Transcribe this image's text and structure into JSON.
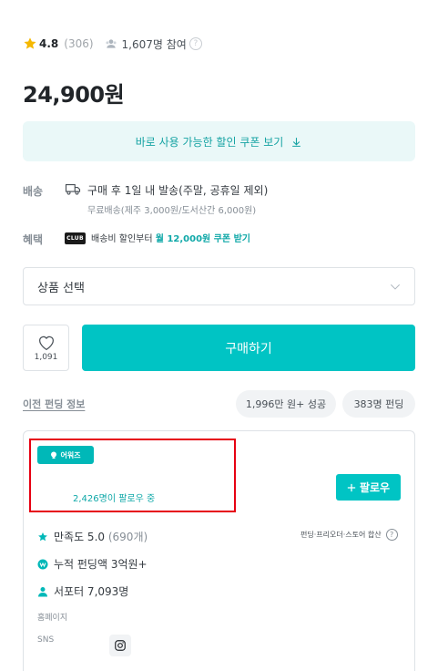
{
  "summary": {
    "rating": "4.8",
    "rating_count": "(306)",
    "participants": "1,607명 참여",
    "help_glyph": "?"
  },
  "price": "24,900원",
  "coupon_button": {
    "label": "바로 사용 가능한 할인 쿠폰 보기",
    "icon": "arrow-down-icon"
  },
  "shipping": {
    "label": "배송",
    "main": "구매 후 1일 내 발송(주말, 공휴일 제외)",
    "sub": "무료배송(제주 3,000원/도서산간 6,000원)",
    "icon": "truck-icon"
  },
  "benefit": {
    "label": "혜택",
    "badge": "CLUB",
    "text_prefix": "배송비 할인부터 ",
    "link": "월 12,000원 쿠폰 받기"
  },
  "product_select": {
    "placeholder": "상품 선택",
    "icon": "chevron-down-icon"
  },
  "like": {
    "count": "1,091",
    "icon": "heart-icon"
  },
  "buy_button": "구매하기",
  "prev_funding": {
    "link": "이전 펀딩 정보",
    "pill_amount": "1,996만 원+ 성공",
    "pill_people": "383명 펀딩"
  },
  "maker": {
    "badge": "어워즈",
    "followers": "2,426명이 팔로우 중",
    "follow_button": "팔로우",
    "follow_icon": "plus-icon",
    "stats": {
      "satisfaction": "만족도 5.0",
      "satisfaction_count": "(690개)",
      "total_funding": "누적 펀딩액 3억원+",
      "supporters": "서포터 7,093명"
    },
    "scope_note": "펀딩·프리오더·스토어 합산",
    "homepage_label": "홈페이지",
    "sns_label": "SNS"
  },
  "colors": {
    "accent": "#00c4c4",
    "accent_text": "#16a3a3",
    "coupon_bg": "#eaf8f8",
    "star": "#f5b800",
    "highlight": "#e60012"
  }
}
